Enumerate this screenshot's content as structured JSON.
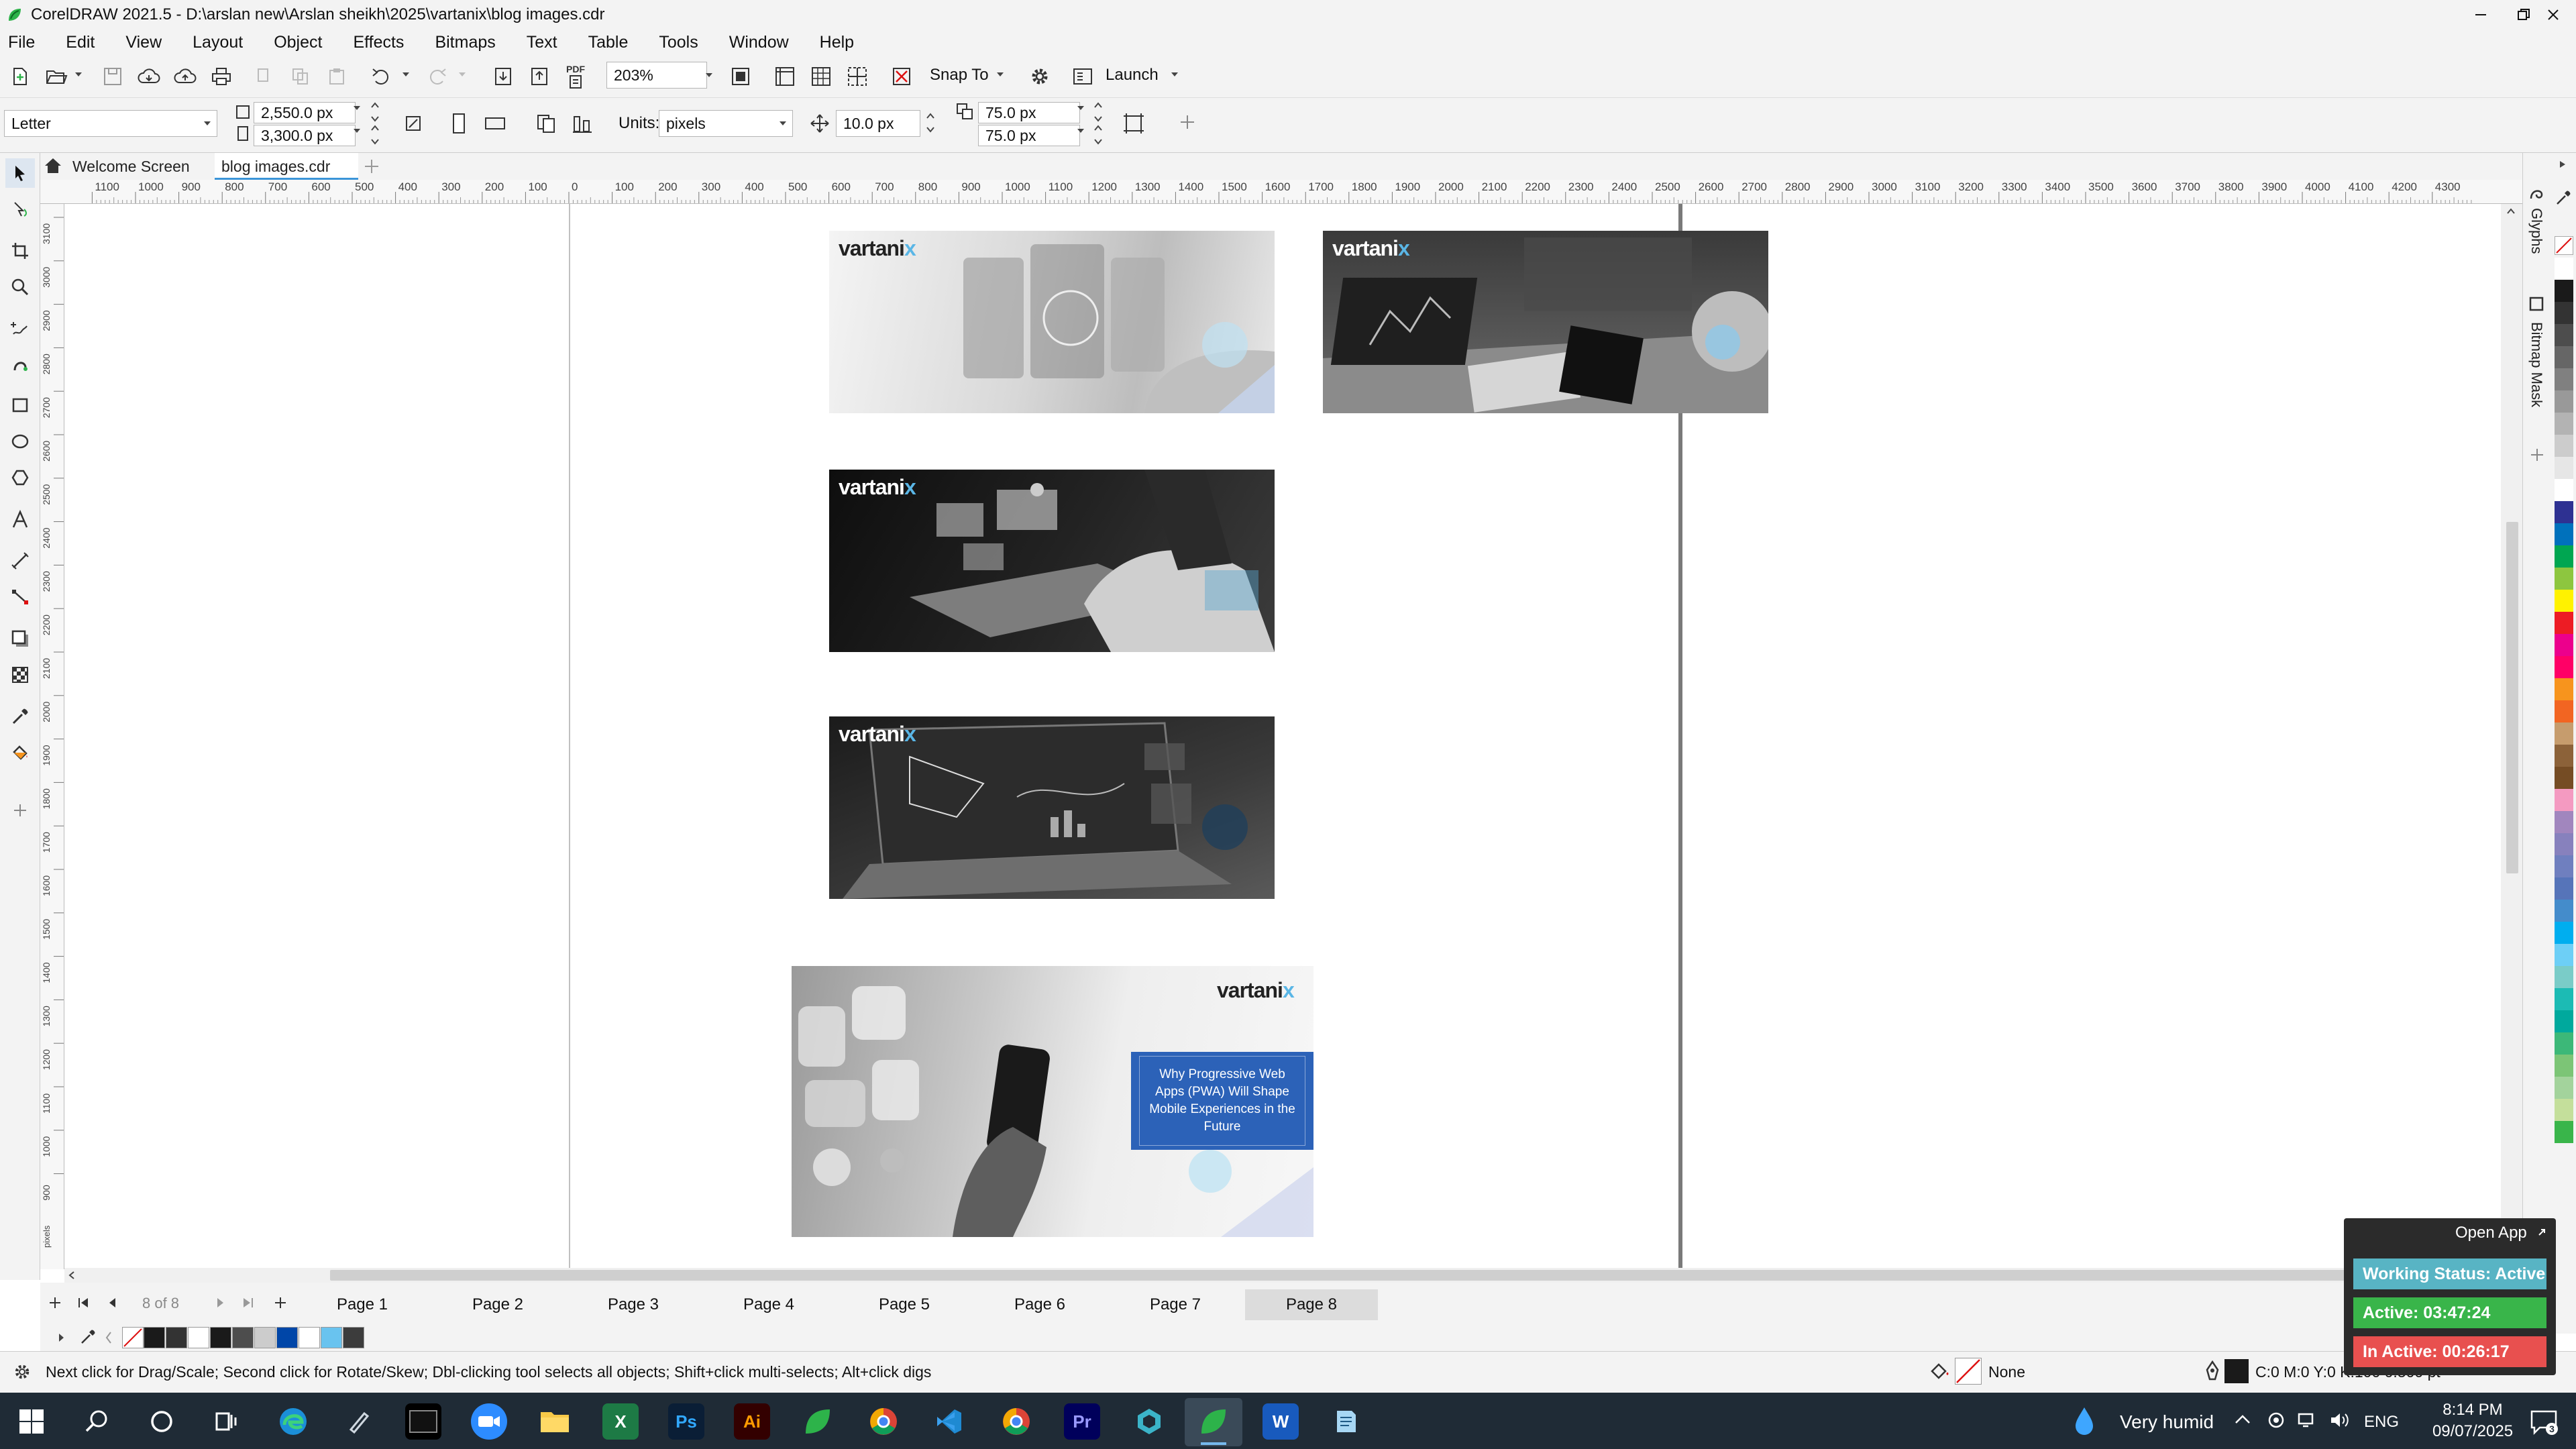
{
  "window": {
    "title": "CorelDRAW 2021.5 - D:\\arslan new\\Arslan sheikh\\2025\\vartanix\\blog images.cdr"
  },
  "menu": [
    "File",
    "Edit",
    "View",
    "Layout",
    "Object",
    "Effects",
    "Bitmaps",
    "Text",
    "Table",
    "Tools",
    "Window",
    "Help"
  ],
  "toolbar": {
    "zoom": "203%",
    "snap_label": "Snap To",
    "launch_label": "Launch",
    "pdf_label": "PDF"
  },
  "property_bar": {
    "page_size": "Letter",
    "width": "2,550.0 px",
    "height": "3,300.0 px",
    "units_label": "Units:",
    "units_value": "pixels",
    "nudge": "10.0 px",
    "dup_x": "75.0 px",
    "dup_y": "75.0 px"
  },
  "doc_tabs": {
    "welcome": "Welcome Screen",
    "active": "blog images.cdr"
  },
  "rulers": {
    "horizontal": [
      "1100",
      "1000",
      "900",
      "800",
      "700",
      "600",
      "500",
      "400",
      "300",
      "200",
      "100",
      "0",
      "100",
      "200",
      "300",
      "400",
      "500",
      "600",
      "700",
      "800",
      "900",
      "1000",
      "1100",
      "1200",
      "1300",
      "1400",
      "1500",
      "1600",
      "1700",
      "1800",
      "1900",
      "2000",
      "2100",
      "2200",
      "2300",
      "2400",
      "2500",
      "2600",
      "2700",
      "2800",
      "2900",
      "3000",
      "3100",
      "3200",
      "3300",
      "3400",
      "3500",
      "3600",
      "3700",
      "3800",
      "3900",
      "4000",
      "4100",
      "4200",
      "4300"
    ],
    "vertical": [
      "3100",
      "3000",
      "2900",
      "2800",
      "2700",
      "2600",
      "2500",
      "2400",
      "2300",
      "2200",
      "2100",
      "2000",
      "1900",
      "1800",
      "1700",
      "1600",
      "1500",
      "1400",
      "1300",
      "1200",
      "1100",
      "1000",
      "900"
    ],
    "unit": "pixels"
  },
  "canvas": {
    "logo_main": "vartani",
    "logo_x": "x",
    "banner_text": "Why Progressive Web Apps (PWA) Will Shape Mobile Experiences in the Future"
  },
  "dockers": [
    "Glyphs",
    "Bitmap Mask"
  ],
  "palette_colors": [
    "#ffffff",
    "#1a1a1a",
    "#333333",
    "#4d4d4d",
    "#666666",
    "#808080",
    "#999999",
    "#b3b3b3",
    "#cccccc",
    "#e6e6e6",
    "#ffffff",
    "#2e3192",
    "#0071bc",
    "#00a651",
    "#8dc63f",
    "#fff200",
    "#ed1c24",
    "#ec008c",
    "#ff0066",
    "#f7941d",
    "#f26522",
    "#c69c6d",
    "#8c6239",
    "#754c24",
    "#f49ac1",
    "#a186be",
    "#8781bd",
    "#6f7fbf",
    "#5674b9",
    "#448ccb",
    "#00aeef",
    "#6dcff6",
    "#7accc8",
    "#1cbbb4",
    "#00a99d",
    "#3cb878",
    "#7cc576",
    "#a3d39c",
    "#c4df9b",
    "#39b54a"
  ],
  "page_nav": {
    "counter": "8 of 8",
    "pages": [
      "Page 1",
      "Page 2",
      "Page 3",
      "Page 4",
      "Page 5",
      "Page 6",
      "Page 7",
      "Page 8"
    ],
    "active": "Page 8"
  },
  "doc_palette": [
    "#1a1a1a",
    "#333333",
    "#ffffff",
    "#1a1a1a",
    "#4d4d4d",
    "#cccccc",
    "#0046a8",
    "#ffffff",
    "#69c3ef",
    "#3c3c3c"
  ],
  "status": {
    "hint": "Next click for Drag/Scale; Second click for Rotate/Skew; Dbl-clicking tool selects all objects; Shift+click multi-selects; Alt+click digs",
    "fill_label": "None",
    "color_info": "C:0 M:0 Y:0 K:100  0.500 pt"
  },
  "time_widget": {
    "open_app": "Open App",
    "working_status": "Working Status: Active",
    "active": "Active: 03:47:24",
    "inactive": "In Active: 00:26:17",
    "colors": {
      "status": "#58b4c4",
      "active": "#39b54a",
      "inactive": "#e8504f"
    }
  },
  "taskbar": {
    "apps": [
      "windows",
      "search",
      "cortana",
      "task-view",
      "edge",
      "pen",
      "terminal",
      "zoom",
      "file-explorer",
      "excel",
      "photoshop",
      "illustrator",
      "coreldraw",
      "chrome",
      "vscode",
      "chrome-profile",
      "premiere",
      "app",
      "coreldraw-active",
      "word",
      "notepad"
    ],
    "icon_labels": {
      "excel": "X",
      "photoshop": "Ps",
      "illustrator": "Ai",
      "premiere": "Pr",
      "word": "W"
    },
    "weather": "Very humid",
    "language": "ENG",
    "time": "8:14 PM",
    "date": "09/07/2025"
  }
}
